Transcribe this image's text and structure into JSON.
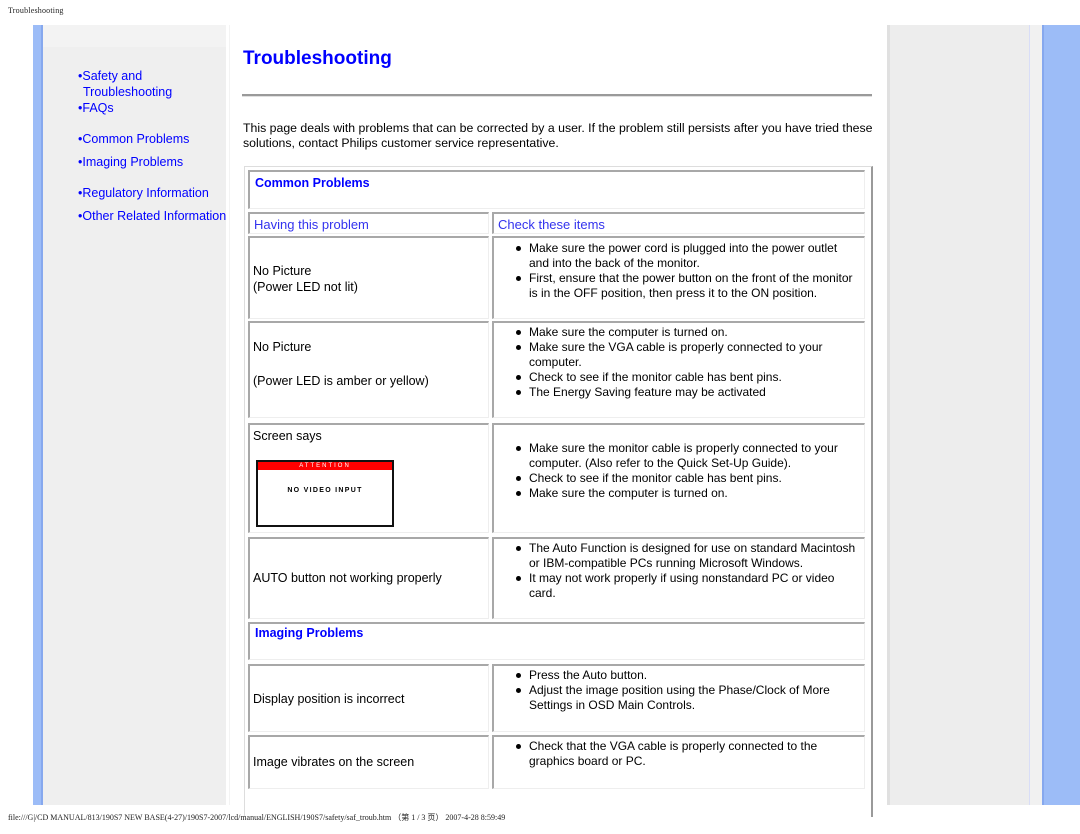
{
  "print_header": "Troubleshooting",
  "print_footer": "file:///G|/CD MANUAL/813/190S7 NEW BASE(4-27)/190S7-2007/lcd/manual/ENGLISH/190S7/safety/saf_troub.htm （第 1 / 3 页） 2007-4-28 8:59:49",
  "sidebar": {
    "items": [
      {
        "label": "•Safety and"
      },
      {
        "label": "Troubleshooting"
      },
      {
        "label": "•FAQs"
      },
      {
        "label": "•Common Problems"
      },
      {
        "label": "•Imaging Problems"
      },
      {
        "label": "•Regulatory Information"
      },
      {
        "label": "•Other Related Information"
      }
    ]
  },
  "page": {
    "title": "Troubleshooting",
    "intro": "This page deals with problems that can be corrected by a user. If the problem still persists after you have tried these solutions, contact Philips customer service representative."
  },
  "common": {
    "title": "Common Problems",
    "col_problem": "Having this problem",
    "col_check": "Check these items",
    "rows": [
      {
        "problem": [
          "No Picture",
          "(Power LED not lit)"
        ],
        "checks": [
          "Make sure the power cord is plugged into the power outlet and into the back of the monitor.",
          "First, ensure that the power button on the front of the monitor is in the OFF position, then press it to the ON position."
        ]
      },
      {
        "problem": [
          "No Picture",
          "(Power LED is amber or yellow)"
        ],
        "checks": [
          "Make sure the computer is turned on.",
          "Make sure the VGA cable is properly connected to your computer.",
          "Check to see if the monitor cable has bent pins.",
          "The Energy Saving feature may be activated"
        ]
      },
      {
        "problem": [
          "Screen says"
        ],
        "osd": {
          "header": "ATTENTION",
          "message": "NO VIDEO INPUT",
          "header_color": "#ff0000"
        },
        "checks": [
          "Make sure the monitor cable is properly connected to your computer. (Also refer to the Quick Set-Up Guide).",
          "Check to see if the monitor cable has bent pins.",
          "Make sure the computer is turned on."
        ]
      },
      {
        "problem": [
          "AUTO button not working properly"
        ],
        "checks": [
          "The Auto Function is designed for use on standard Macintosh or IBM-compatible PCs running Microsoft Windows.",
          "It may not work properly if using nonstandard PC or video card."
        ]
      }
    ]
  },
  "imaging": {
    "title": "Imaging Problems",
    "rows": [
      {
        "problem": [
          "Display position is incorrect"
        ],
        "checks": [
          "Press the Auto button.",
          "Adjust the image position using the Phase/Clock of More Settings in OSD Main Controls."
        ]
      },
      {
        "problem": [
          "Image vibrates on the screen"
        ],
        "checks": [
          "Check that the VGA cable is properly connected to the graphics board or PC."
        ]
      }
    ]
  },
  "colors": {
    "link": "#0000ff",
    "side_bar": "#9cbcf7",
    "panel": "#efefef"
  }
}
